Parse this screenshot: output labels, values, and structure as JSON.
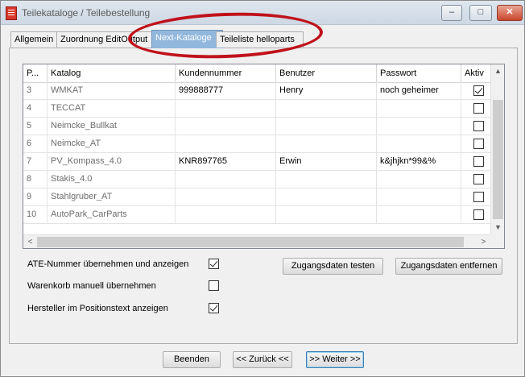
{
  "window": {
    "title": "Teilekataloge / Teilebestellung",
    "controls": {
      "minimize": "–",
      "maximize": "□",
      "close": "✕"
    }
  },
  "tabs": [
    {
      "label": "Allgemein",
      "active": false
    },
    {
      "label": "Zuordnung EditOutput",
      "active": false
    },
    {
      "label": "Next-Kataloge",
      "active": true
    },
    {
      "label": "Teileliste helloparts",
      "active": false
    }
  ],
  "grid": {
    "columns": [
      "P...",
      "Katalog",
      "Kundennummer",
      "Benutzer",
      "Passwort",
      "Aktiv"
    ],
    "rows": [
      {
        "pos": "3",
        "katalog": "WMKAT",
        "kundennummer": "999888777",
        "benutzer": "Henry",
        "passwort": "noch geheimer",
        "aktiv": true
      },
      {
        "pos": "4",
        "katalog": "TECCAT",
        "kundennummer": "",
        "benutzer": "",
        "passwort": "",
        "aktiv": false
      },
      {
        "pos": "5",
        "katalog": "Neimcke_Bullkat",
        "kundennummer": "",
        "benutzer": "",
        "passwort": "",
        "aktiv": false
      },
      {
        "pos": "6",
        "katalog": "Neimcke_AT",
        "kundennummer": "",
        "benutzer": "",
        "passwort": "",
        "aktiv": false
      },
      {
        "pos": "7",
        "katalog": "PV_Kompass_4.0",
        "kundennummer": "KNR897765",
        "benutzer": "Erwin",
        "passwort": "k&jhjkn*99&%",
        "aktiv": false
      },
      {
        "pos": "8",
        "katalog": "Stakis_4.0",
        "kundennummer": "",
        "benutzer": "",
        "passwort": "",
        "aktiv": false
      },
      {
        "pos": "9",
        "katalog": "Stahlgruber_AT",
        "kundennummer": "",
        "benutzer": "",
        "passwort": "",
        "aktiv": false
      },
      {
        "pos": "10",
        "katalog": "AutoPark_CarParts",
        "kundennummer": "",
        "benutzer": "",
        "passwort": "",
        "aktiv": false
      }
    ],
    "scroll": {
      "up": "▲",
      "down": "▼",
      "left": "<",
      "right": ">"
    }
  },
  "options": [
    {
      "label": "ATE-Nummer übernehmen und anzeigen",
      "checked": true
    },
    {
      "label": "Warenkorb manuell übernehmen",
      "checked": false
    },
    {
      "label": "Hersteller im Positionstext anzeigen",
      "checked": true
    }
  ],
  "buttons": {
    "test_access": "Zugangsdaten testen",
    "remove_access": "Zugangsdaten entfernen",
    "finish": "Beenden",
    "back": "<< Zurück <<",
    "next": ">> Weiter >>"
  },
  "colors": {
    "active_tab": "#91b7dc",
    "highlight_ellipse": "#c0121b",
    "close_button": "#c9452c"
  }
}
